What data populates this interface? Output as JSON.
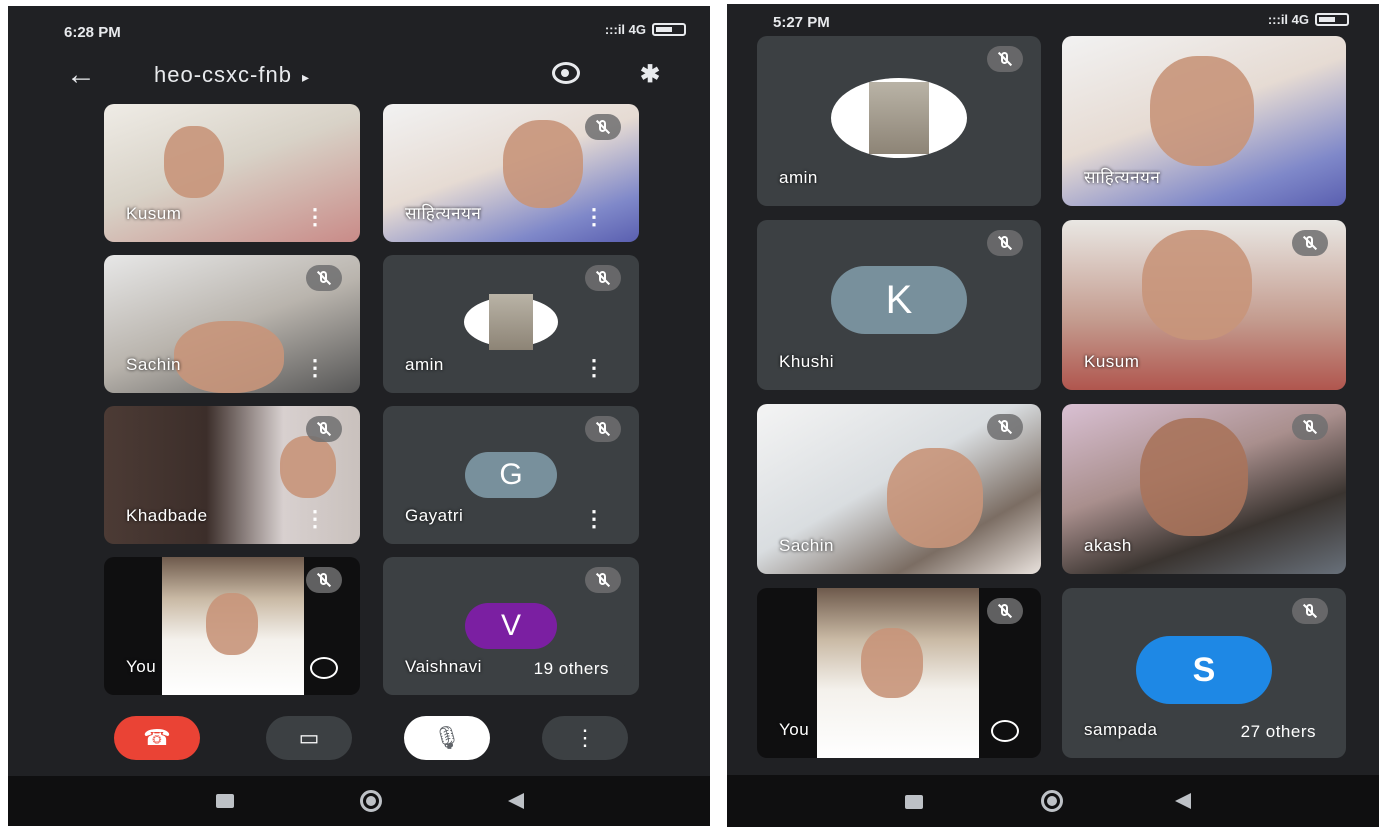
{
  "left": {
    "status": {
      "time": "6:28 PM",
      "network": ":::il 4G"
    },
    "meeting_code": "heo-csxc-fnb",
    "caret": "▸",
    "back_glyph": "←",
    "bluetooth_glyph": "✱",
    "tiles": [
      {
        "name": "Kusum"
      },
      {
        "name": "साहित्यनयन"
      },
      {
        "name": "Sachin"
      },
      {
        "name": "amin"
      },
      {
        "name": "Khadbade"
      },
      {
        "name": "Gayatri",
        "initial": "G",
        "avatar_color": "#78909c"
      },
      {
        "name": "You"
      },
      {
        "name": "Vaishnavi",
        "initial": "V",
        "avatar_color": "#7b1fa2",
        "others": "19 others"
      }
    ],
    "controls": {
      "end_call_glyph": "☎",
      "camera_glyph": "▭",
      "mic_glyph": "🎙",
      "more_glyph": "⋮"
    }
  },
  "right": {
    "status": {
      "time": "5:27 PM",
      "network": ":::il 4G"
    },
    "tiles": [
      {
        "name": "amin"
      },
      {
        "name": "साहित्यनयन"
      },
      {
        "name": "Khushi",
        "initial": "K",
        "avatar_color": "#78909c"
      },
      {
        "name": "Kusum"
      },
      {
        "name": "Sachin"
      },
      {
        "name": "akash"
      },
      {
        "name": "You"
      },
      {
        "name": "sampada",
        "initial": "S",
        "avatar_color": "#1e88e5",
        "others": "27 others"
      }
    ]
  },
  "dots_glyph": "⋮",
  "colors": {
    "background": "#202124",
    "tile": "#3c4043",
    "end_call": "#ea4335",
    "mic_button": "#ffffff"
  }
}
